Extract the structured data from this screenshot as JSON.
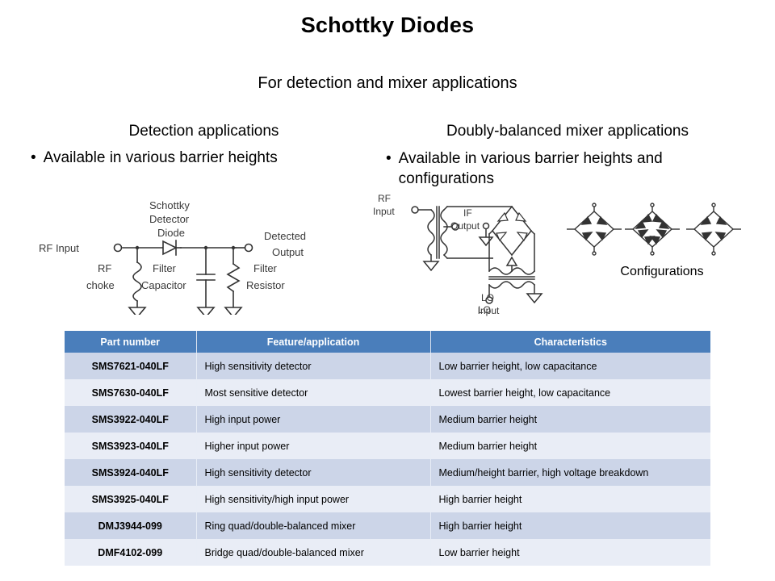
{
  "slide": {
    "title": "Schottky Diodes",
    "subtitle": "For detection and mixer applications",
    "left_column": {
      "heading": "Detection applications",
      "bullet": "Available in various barrier heights",
      "bullet_marker": "•"
    },
    "right_column": {
      "heading": "Doubly-balanced mixer applications",
      "bullet": "Available in various barrier heights and configurations",
      "bullet_marker": "•"
    }
  },
  "detector_diagram": {
    "labels": {
      "rf_input": "RF Input",
      "diode_l1": "Schottky",
      "diode_l2": "Detector",
      "diode_l3": "Diode",
      "output_l1": "Detected",
      "output_l2": "Output",
      "choke_l1": "RF",
      "choke_l2": "choke",
      "cap_l1": "Filter",
      "cap_l2": "Capacitor",
      "res_l1": "Filter",
      "res_l2": "Resistor"
    }
  },
  "mixer_diagram": {
    "labels": {
      "rf_l1": "RF",
      "rf_l2": "Input",
      "if_l1": "IF",
      "if_l2": "Output",
      "lo_l1": "LO",
      "lo_l2": "Input"
    }
  },
  "configurations": {
    "label": "Configurations",
    "count": 3
  },
  "table": {
    "columns": [
      "Part number",
      "Feature/application",
      "Characteristics"
    ],
    "rows": [
      {
        "part": "SMS7621-040LF",
        "feature": "High sensitivity detector",
        "characteristics": "Low barrier height, low capacitance"
      },
      {
        "part": "SMS7630-040LF",
        "feature": "Most sensitive detector",
        "characteristics": "Lowest barrier height, low capacitance"
      },
      {
        "part": "SMS3922-040LF",
        "feature": "High input power",
        "characteristics": "Medium barrier height"
      },
      {
        "part": "SMS3923-040LF",
        "feature": "Higher input power",
        "characteristics": "Medium barrier height"
      },
      {
        "part": "SMS3924-040LF",
        "feature": "High sensitivity detector",
        "characteristics": "Medium/height barrier, high voltage breakdown"
      },
      {
        "part": "SMS3925-040LF",
        "feature": "High sensitivity/high input power",
        "characteristics": "High barrier height"
      },
      {
        "part": "DMJ3944-099",
        "feature": "Ring quad/double-balanced mixer",
        "characteristics": "High barrier height"
      },
      {
        "part": "DMF4102-099",
        "feature": "Bridge quad/double-balanced  mixer",
        "characteristics": "Low barrier height"
      }
    ]
  },
  "colors": {
    "header_blue": "#4a7ebb",
    "row_odd": "#ccd5e8",
    "row_even": "#e9edf6",
    "text": "#000000",
    "diagram_line": "#333333"
  }
}
